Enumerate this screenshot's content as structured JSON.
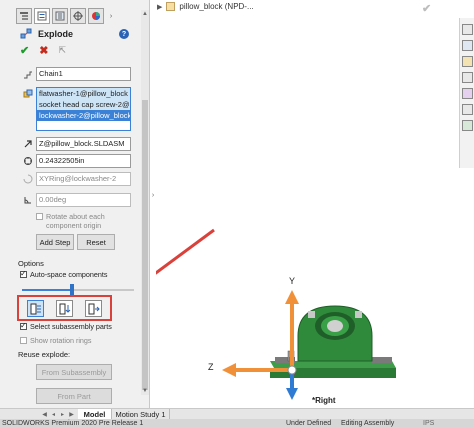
{
  "property_manager": {
    "title": "Explode",
    "chain_value": "Chain1",
    "components": [
      "flatwasher-1@pillow_block",
      "socket head cap screw-2@pillow",
      "lockwasher-2@pillow_block"
    ],
    "direction_value": "Z@pillow_block.SLDASM",
    "distance_value": "0.24322505in",
    "rotation_axis_value": "XYRing@lockwasher-2",
    "angle_value": "0.00deg",
    "rotate_origin_label": "Rotate about each component origin",
    "add_step_label": "Add Step",
    "reset_label": "Reset",
    "options_label": "Options",
    "auto_space_label": "Auto-space components",
    "auto_space_slider_fraction": 0.45,
    "select_subassembly_label": "Select subassembly parts",
    "show_rotation_rings_label": "Show rotation rings",
    "reuse_explode_label": "Reuse explode:",
    "from_subassembly_label": "From Subassembly",
    "from_part_label": "From Part"
  },
  "graphics": {
    "tree_item": "pillow_block  (NPD-...",
    "view_orientation": "*Right",
    "axis_y": "Y",
    "axis_z": "Z"
  },
  "bottom_tabs": [
    "Model",
    "Motion Study 1"
  ],
  "status_bar": {
    "app": "SOLIDWORKS Premium 2020 Pre Release 1",
    "state": "Under Defined",
    "mode": "Editing Assembly",
    "units": "IPS"
  },
  "colors": {
    "accent": "#3b82d6",
    "highlight_box": "#d9413a",
    "arrow": "#d9413a",
    "part_green": "#2f8a3b",
    "triad_orange": "#f0913a",
    "triad_blue": "#2f7bd4"
  }
}
